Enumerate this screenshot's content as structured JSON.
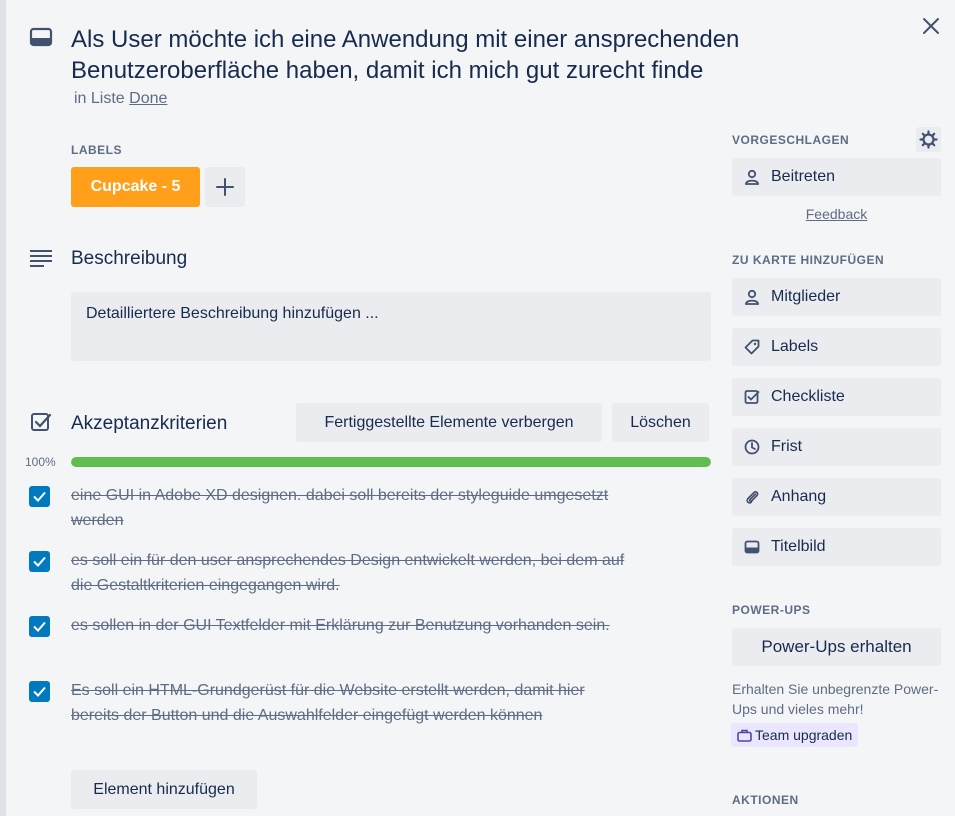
{
  "card": {
    "title": "Als User möchte ich eine Anwendung mit einer ansprechenden Benutzeroberfläche haben, damit ich mich gut zurecht finde",
    "in_list_prefix": "in Liste",
    "list_name": "Done"
  },
  "labels": {
    "heading": "LABELS",
    "items": [
      {
        "text": "Cupcake - 5",
        "color": "#ff9f1a"
      }
    ],
    "add_symbol": "+"
  },
  "description": {
    "heading": "Beschreibung",
    "placeholder": "Detailliertere Beschreibung hinzufügen ..."
  },
  "checklist": {
    "title": "Akzeptanzkriterien",
    "hide_button": "Fertiggestellte Elemente verbergen",
    "delete_button": "Löschen",
    "progress_label": "100%",
    "progress_value": 1.0,
    "items": [
      {
        "text": "eine GUI in Adobe XD designen. dabei soll bereits der styleguide umgesetzt werden",
        "checked": true
      },
      {
        "text": "es soll ein für den user ansprechendes Design entwickelt werden, bei dem auf die Gestaltkriterien eingegangen wird.",
        "checked": true
      },
      {
        "text": "es sollen in der GUI Textfelder mit Erklärung zur Benutzung vorhanden sein.",
        "checked": true
      },
      {
        "text": "Es soll ein HTML-Grundgerüst für die Website erstellt werden, damit hier bereits der Button und die Auswahlfelder eingefügt werden können",
        "checked": true
      }
    ],
    "add_item_button": "Element hinzufügen"
  },
  "sidebar": {
    "suggested_heading": "VORGESCHLAGEN",
    "join_button": "Beitreten",
    "feedback_link": "Feedback",
    "add_to_card_heading": "ZU KARTE HINZUFÜGEN",
    "add_buttons": [
      {
        "label": "Mitglieder",
        "icon": "person-icon"
      },
      {
        "label": "Labels",
        "icon": "tag-icon"
      },
      {
        "label": "Checkliste",
        "icon": "checklist-icon"
      },
      {
        "label": "Frist",
        "icon": "clock-icon"
      },
      {
        "label": "Anhang",
        "icon": "paperclip-icon"
      },
      {
        "label": "Titelbild",
        "icon": "cover-icon"
      }
    ],
    "powerups_heading": "POWER-UPS",
    "powerups_button": "Power-Ups erhalten",
    "powerups_info": "Erhalten Sie unbegrenzte Power-Ups und vieles mehr!",
    "team_upgrade": "Team upgraden",
    "actions_heading": "AKTIONEN"
  },
  "colors": {
    "background": "#f4f5f7",
    "checkbox": "#0079bf",
    "progress": "#61bd4f",
    "label_orange": "#ff9f1a",
    "team_chip": "#eae6ff"
  }
}
